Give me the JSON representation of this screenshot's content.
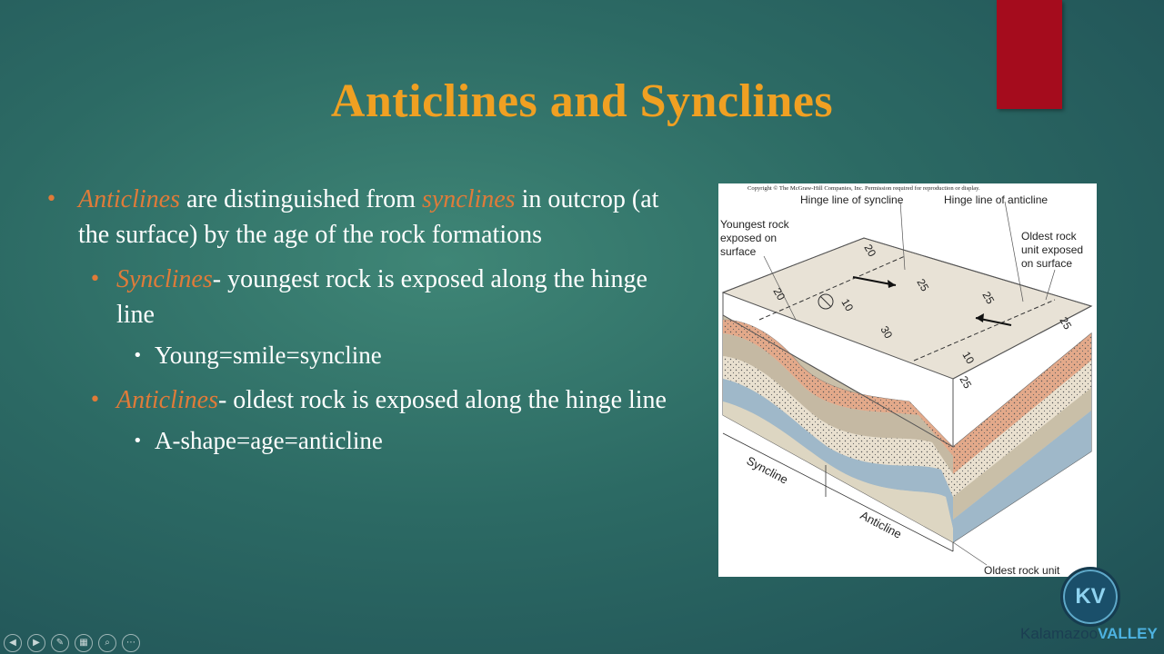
{
  "slide": {
    "title": "Anticlines and Synclines",
    "bullets": {
      "b1_kw1": "Anticlines",
      "b1_mid": " are distinguished from ",
      "b1_kw2": "synclines",
      "b1_rest": " in outcrop (at the surface) by the age of the rock formations",
      "b2_kw": "Synclines",
      "b2_rest": "- youngest rock is exposed along the hinge line",
      "b3": "Young=smile=syncline",
      "b4_kw": "Anticlines",
      "b4_rest": "- oldest rock is exposed along the hinge line",
      "b5": "A-shape=age=anticline"
    }
  },
  "figure": {
    "copyright": "Copyright © The McGraw-Hill Companies, Inc. Permission required for reproduction or display.",
    "hinge_syncline": "Hinge line of syncline",
    "hinge_anticline": "Hinge line of anticline",
    "youngest_1": "Youngest rock",
    "youngest_2": "exposed on",
    "youngest_3": "surface",
    "oldest_1": "Oldest rock",
    "oldest_2": "unit exposed",
    "oldest_3": "on surface",
    "syncline_label": "Syncline",
    "anticline_label": "Anticline",
    "oldest_unit": "Oldest rock unit",
    "dips": [
      "20",
      "10",
      "20",
      "30",
      "25",
      "10",
      "25",
      "25",
      "25"
    ]
  },
  "logo": {
    "initials": "KV",
    "text_a": "Kalamazoo",
    "text_b": "VALLEY"
  },
  "controls": [
    "prev-icon",
    "next-icon",
    "pen-icon",
    "slides-icon",
    "zoom-icon",
    "more-icon"
  ],
  "colors": {
    "title": "#f0a022",
    "keyword": "#e07b39",
    "red_tab": "#a50c1d"
  }
}
